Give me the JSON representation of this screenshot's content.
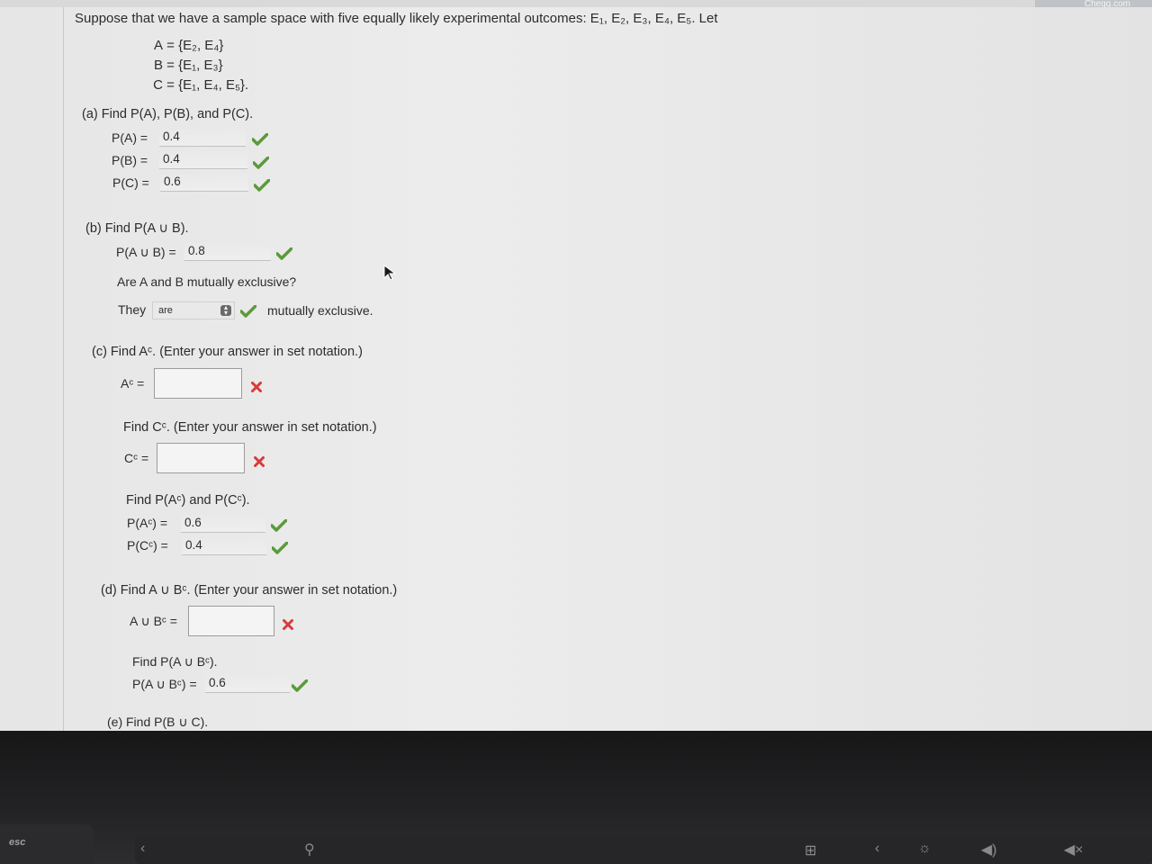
{
  "corner_badge": "Chegg.com",
  "intro_text": "Suppose that we have a sample space with five equally likely experimental outcomes: E₁, E₂, E₃, E₄, E₅. Let",
  "sets": {
    "A": {
      "name": "A",
      "value": "{E₂, E₄}"
    },
    "B": {
      "name": "B",
      "value": "{E₁, E₃}"
    },
    "C": {
      "name": "C",
      "value": "{E₁, E₄, E₅}."
    }
  },
  "part_a": {
    "prompt": "(a)   Find P(A), P(B), and P(C).",
    "rows": [
      {
        "label": "P(A)  =",
        "value": "0.4"
      },
      {
        "label": "P(B)  =",
        "value": "0.4"
      },
      {
        "label": "P(C)  =",
        "value": "0.6"
      }
    ]
  },
  "part_b": {
    "prompt": "(b)   Find P(A ∪ B).",
    "row_label": "P(A ∪ B)  =",
    "row_value": "0.8",
    "question": "Are A and B mutually exclusive?",
    "they": "They",
    "select_value": "are",
    "suffix": "mutually exclusive."
  },
  "part_c": {
    "prompt": "(c)   Find Aᶜ. (Enter your answer in set notation.)",
    "ac_label": "Aᶜ =",
    "cc_prompt": "Find Cᶜ. (Enter your answer in set notation.)",
    "cc_label": "Cᶜ =",
    "prob_prompt": "Find P(Aᶜ) and P(Cᶜ).",
    "prob_rows": [
      {
        "label": "P(Aᶜ)  =",
        "value": "0.6"
      },
      {
        "label": "P(Cᶜ)  =",
        "value": "0.4"
      }
    ]
  },
  "part_d": {
    "prompt": "(d)   Find A ∪ Bᶜ. (Enter your answer in set notation.)",
    "label": "A ∪ Bᶜ =",
    "prob_prompt": "Find P(A ∪ Bᶜ).",
    "prob_label": "P(A ∪ Bᶜ)  =",
    "prob_value": "0.6"
  },
  "part_e": {
    "prompt": "(e)   Find P(B ∪ C)."
  },
  "keyboard": {
    "esc_label": "esc"
  },
  "colors": {
    "check": "#5b9a3a",
    "cross": "#d83a3a"
  }
}
